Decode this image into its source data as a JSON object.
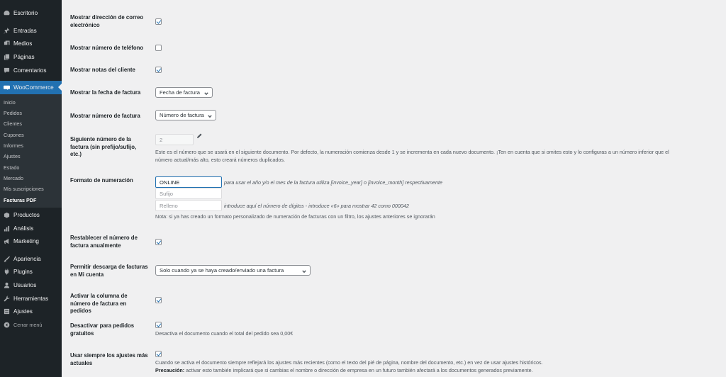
{
  "sidebar": {
    "items": [
      {
        "label": "Escritorio",
        "icon": "dashboard-icon"
      },
      {
        "label": "Entradas",
        "icon": "pin-icon"
      },
      {
        "label": "Medios",
        "icon": "media-icon"
      },
      {
        "label": "Páginas",
        "icon": "pages-icon"
      },
      {
        "label": "Comentarios",
        "icon": "comments-icon"
      },
      {
        "label": "WooCommerce",
        "icon": "woocommerce-icon",
        "active": true
      },
      {
        "label": "Productos",
        "icon": "products-icon"
      },
      {
        "label": "Análisis",
        "icon": "analytics-icon"
      },
      {
        "label": "Marketing",
        "icon": "megaphone-icon"
      },
      {
        "label": "Apariencia",
        "icon": "brush-icon"
      },
      {
        "label": "Plugins",
        "icon": "plugins-icon"
      },
      {
        "label": "Usuarios",
        "icon": "users-icon"
      },
      {
        "label": "Herramientas",
        "icon": "tools-icon"
      },
      {
        "label": "Ajustes",
        "icon": "settings-icon"
      },
      {
        "label": "Cerrar menú",
        "icon": "collapse-icon"
      }
    ],
    "submenu": [
      "Inicio",
      "Pedidos",
      "Clientes",
      "Cupones",
      "Informes",
      "Ajustes",
      "Estado",
      "Mercado",
      "Mis suscripciones",
      "Facturas PDF"
    ],
    "submenu_current": "Facturas PDF"
  },
  "settings": {
    "show_email": {
      "label": "Mostrar dirección de correo electrónico",
      "checked": true
    },
    "show_phone": {
      "label": "Mostrar número de teléfono",
      "checked": false
    },
    "show_notes": {
      "label": "Mostrar notas del cliente",
      "checked": true
    },
    "invoice_date": {
      "label": "Mostrar la fecha de factura",
      "value": "Fecha de factura"
    },
    "invoice_number": {
      "label": "Mostrar número de factura",
      "value": "Número de factura"
    },
    "next_number": {
      "label": "Siguiente número de la factura (sin prefijo/sufijo, etc.)",
      "value": "2",
      "description_1": "Este es el número que se usará en el siguiente documento. Por defecto, la numeración comienza desde 1 y se incrementa en cada nuevo documento. ¡Ten en cuenta que si omites esto y lo configuras a un número inferior que el",
      "description_2": "número actual/más alto, esto creará números duplicados."
    },
    "number_format": {
      "label": "Formato de numeración",
      "prefix_value": "ONLINE",
      "prefix_desc": "para usar el año y/o el mes de la factura utiliza [invoice_year] o [invoice_month] respectivamente",
      "suffix_placeholder": "Sufijo",
      "padding_placeholder": "Relleno",
      "padding_desc": "introduce aquí el número de dígitos - introduce «6» para mostrar 42 como 000042",
      "note": "Nota: si ya has creado un formato personalizado de numeración de facturas con un filtro, los ajustes anteriores se ignorarán"
    },
    "reset_yearly": {
      "label": "Restablecer el número de factura anualmente",
      "checked": true
    },
    "my_account": {
      "label": "Permitir descarga de facturas en Mi cuenta",
      "value": "Solo cuando ya se haya creado/enviado una factura"
    },
    "orders_column": {
      "label": "Activar la columna de número de factura en pedidos",
      "checked": true
    },
    "free_orders": {
      "label": "Desactivar para pedidos gratuitos",
      "checked": true,
      "description": "Desactiva el documento cuando el total del pedido sea 0,00€"
    },
    "latest_settings": {
      "label": "Usar siempre los ajustes más actuales",
      "checked": true,
      "description": "Cuando se activa el documento siempre reflejará los ajustes más recientes (como el texto del pié de página, nombre del documento, etc.) en vez de usar ajustes históricos.",
      "warning_label": "Precaución:",
      "warning_text": " activar esto también implicará que si cambias el nombre o dirección de empresa en un futuro también afectará a los documentos generados previamente."
    }
  }
}
